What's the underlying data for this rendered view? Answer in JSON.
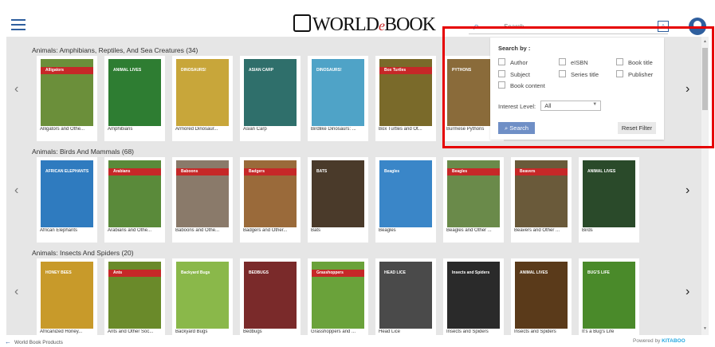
{
  "header": {
    "logo": "WORLD",
    "logo_e": "e",
    "logo_end": "BOOK",
    "search_placeholder": "Search"
  },
  "filter": {
    "search_by_label": "Search by :",
    "options": [
      "Author",
      "eISBN",
      "Book title",
      "Subject",
      "Series title",
      "Publisher",
      "Book content"
    ],
    "interest_label": "Interest Level:",
    "interest_value": "All",
    "search_button": "Search",
    "reset_button": "Reset Filter"
  },
  "sections": [
    {
      "title": "Animals: Amphibians, Reptiles, And Sea Creatures (34)",
      "books": [
        {
          "label": "Alligators and Othe...",
          "color": "#6b8f3a",
          "band": "#c62828",
          "band_text": "Alligators"
        },
        {
          "label": "Amphibians",
          "color": "#2e7d32",
          "band": "",
          "band_text": "ANIMAL LIVES"
        },
        {
          "label": "Armored Dinosaur...",
          "color": "#c8a63a",
          "band": "",
          "band_text": "DINOSAURS!"
        },
        {
          "label": "Asian Carp",
          "color": "#2f6f6b",
          "band": "",
          "band_text": "ASIAN CARP"
        },
        {
          "label": "Birdlike Dinosaurs: ...",
          "color": "#4fa3c7",
          "band": "",
          "band_text": "DINOSAURS!"
        },
        {
          "label": "Box Turtles and Ot...",
          "color": "#7a6a2a",
          "band": "#c62828",
          "band_text": "Box Turtles"
        },
        {
          "label": "Burmese Pythons",
          "color": "#8a6b3a",
          "band": "",
          "band_text": "PYTHONS"
        }
      ]
    },
    {
      "title": "Animals: Birds And Mammals (68)",
      "books": [
        {
          "label": "African Elephants",
          "color": "#2f7bbf",
          "band": "",
          "band_text": "AFRICAN ELEPHANTS"
        },
        {
          "label": "Arabians and Othe...",
          "color": "#5a8a3a",
          "band": "#c62828",
          "band_text": "Arabians"
        },
        {
          "label": "Baboons and Othe...",
          "color": "#8a7a6a",
          "band": "#c62828",
          "band_text": "Baboons"
        },
        {
          "label": "Badgers and Other...",
          "color": "#9a6a3a",
          "band": "#c62828",
          "band_text": "Badgers"
        },
        {
          "label": "Bats",
          "color": "#4a3a2a",
          "band": "",
          "band_text": "BATS"
        },
        {
          "label": "Beagles",
          "color": "#3a86c8",
          "band": "",
          "band_text": "Beagles"
        },
        {
          "label": "Beagles and Other ...",
          "color": "#6a8a4a",
          "band": "#c62828",
          "band_text": "Beagles"
        },
        {
          "label": "Beavers and Other ...",
          "color": "#6a5a3a",
          "band": "#c62828",
          "band_text": "Beavers"
        },
        {
          "label": "Birds",
          "color": "#2a4a2a",
          "band": "",
          "band_text": "ANIMAL LIVES"
        }
      ]
    },
    {
      "title": "Animals: Insects And Spiders (20)",
      "books": [
        {
          "label": "Africanized Honey...",
          "color": "#c89a2a",
          "band": "",
          "band_text": "HONEY BEES"
        },
        {
          "label": "Ants and Other Soc...",
          "color": "#6a8a2a",
          "band": "#c62828",
          "band_text": "Ants"
        },
        {
          "label": "Backyard Bugs",
          "color": "#8ab84a",
          "band": "",
          "band_text": "Backyard Bugs"
        },
        {
          "label": "Bedbugs",
          "color": "#7a2a2a",
          "band": "",
          "band_text": "BEDBUGS"
        },
        {
          "label": "Grasshoppers and ...",
          "color": "#6aa23a",
          "band": "#c62828",
          "band_text": "Grasshoppers"
        },
        {
          "label": "Head Lice",
          "color": "#4a4a4a",
          "band": "",
          "band_text": "HEAD LICE"
        },
        {
          "label": "Insects and Spiders",
          "color": "#2a2a2a",
          "band": "",
          "band_text": "Insects and Spiders"
        },
        {
          "label": "Insects and Spiders",
          "color": "#5a3a1a",
          "band": "",
          "band_text": "ANIMAL LIVES"
        },
        {
          "label": "It's a Bug's Life",
          "color": "#4a8a2a",
          "band": "",
          "band_text": "BUG'S LIFE"
        }
      ]
    }
  ],
  "footer": {
    "products_link": "World Book Products",
    "powered_by": "Powered by",
    "powered_brand": "KITABOO"
  }
}
